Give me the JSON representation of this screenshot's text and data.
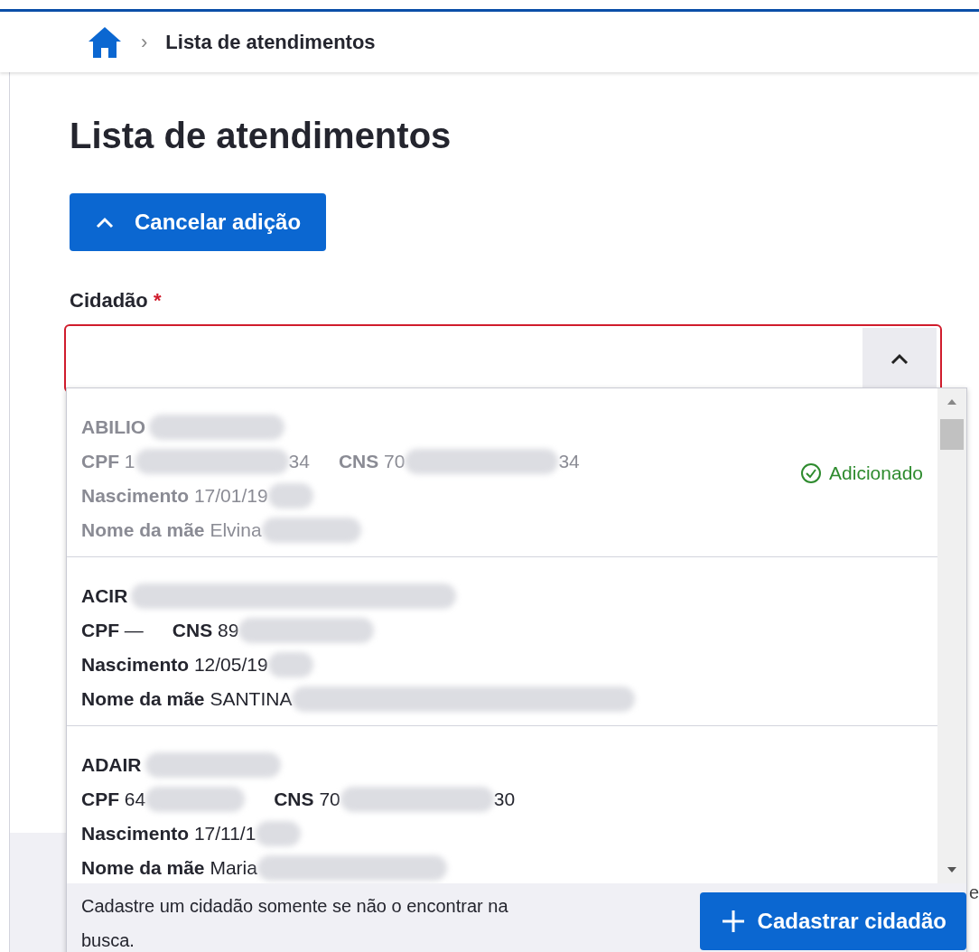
{
  "breadcrumb": {
    "separator": "›",
    "current": "Lista de atendimentos"
  },
  "page_title": "Lista de atendimentos",
  "cancel_button": {
    "label": "Cancelar adição",
    "expanded": true
  },
  "citizen_field": {
    "label": "Cidadão",
    "required_mark": "*",
    "invalid": true,
    "expanded": true
  },
  "results": [
    {
      "name": "ABILIO",
      "disabled": true,
      "status": "Adicionado",
      "lines": [
        [
          {
            "label": "CPF",
            "value": "1",
            "tail": "34"
          },
          {
            "label": "CNS",
            "value": "70",
            "tail": "34"
          }
        ],
        [
          {
            "label": "Nascimento",
            "value": "17/01/19"
          }
        ],
        [
          {
            "label": "Nome da mãe",
            "value": "Elvina"
          }
        ]
      ]
    },
    {
      "name": "ACIR",
      "disabled": false,
      "lines": [
        [
          {
            "label": "CPF",
            "value": "—"
          },
          {
            "label": "CNS",
            "value": "89"
          }
        ],
        [
          {
            "label": "Nascimento",
            "value": "12/05/19"
          }
        ],
        [
          {
            "label": "Nome da mãe",
            "value": "SANTINA"
          }
        ]
      ]
    },
    {
      "name": "ADAIR",
      "disabled": false,
      "lines": [
        [
          {
            "label": "CPF",
            "value": "64"
          },
          {
            "label": "CNS",
            "value": "70",
            "tail": "30"
          }
        ],
        [
          {
            "label": "Nascimento",
            "value": "17/11/1"
          }
        ],
        [
          {
            "label": "Nome da mãe",
            "value": "Maria"
          }
        ]
      ]
    }
  ],
  "footer": {
    "hint": "Cadastre um cidadão somente se não o encontrar na busca.",
    "button": "Cadastrar cidadão"
  },
  "edge_text": "e"
}
